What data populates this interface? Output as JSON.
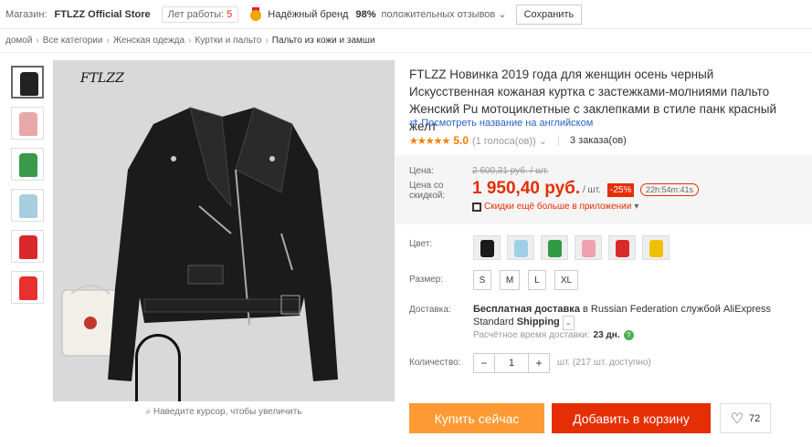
{
  "storebar": {
    "store_label": "Магазин:",
    "store_name": "FTLZZ Official Store",
    "years_label": "Лет работы:",
    "years_value": "5",
    "brand": "Надёжный бренд",
    "feedback_pct": "98%",
    "feedback_label": "положительных отзывов",
    "save_label": "Сохранить"
  },
  "breadcrumbs": [
    "домой",
    "Все категории",
    "Женская одежда",
    "Куртки и пальто",
    "Пальто из кожи и замши"
  ],
  "gallery": {
    "brand_text": "FTLZZ",
    "hint": "Наведите курсор, чтобы увеличить",
    "thumb_colors": [
      "#222222",
      "#e8a8a8",
      "#3a9a4a",
      "#a8cfe0",
      "#d8282c",
      "#e83030"
    ]
  },
  "product": {
    "title": "FTLZZ Новинка 2019 года для женщин осень черный Искусственная кожаная куртка с застежками-молниями пальто Женский Pu мотоциклетные с заклепками в стиле панк красный желт",
    "translate_link": "Посмотреть название на английском",
    "stars": "★★★★★",
    "rating": "5.0",
    "votes": "(1 голоса(ов))",
    "orders": "3 заказа(ов)"
  },
  "price": {
    "price_label": "Цена:",
    "old_price": "2 600,31 руб. / шт.",
    "discount_label": "Цена со скидкой:",
    "new_price": "1 950,40 руб.",
    "unit": "/ шт.",
    "discount": "-25%",
    "timer": "22h:54m:41s",
    "app_promo": "Скидки ещё больше в приложении"
  },
  "options": {
    "color_label": "Цвет:",
    "colors": [
      "#1a1a1a",
      "#9fd0e8",
      "#2e9a44",
      "#f0a0b0",
      "#d82a2a",
      "#f0c000"
    ],
    "size_label": "Размер:",
    "sizes": [
      "S",
      "M",
      "L",
      "XL"
    ]
  },
  "delivery": {
    "label": "Доставка:",
    "free": "Бесплатная доставка",
    "text": "в Russian Federation службой AliExpress Standard",
    "service_tail": "Shipping",
    "eta_label": "Расчётное время доставки:",
    "eta_value": "23 дн."
  },
  "quantity": {
    "label": "Количество:",
    "value": "1",
    "stock": "шт. (217 шт. доступно)"
  },
  "actions": {
    "buy": "Купить сейчас",
    "cart": "Добавить в корзину",
    "wish_count": "72"
  }
}
